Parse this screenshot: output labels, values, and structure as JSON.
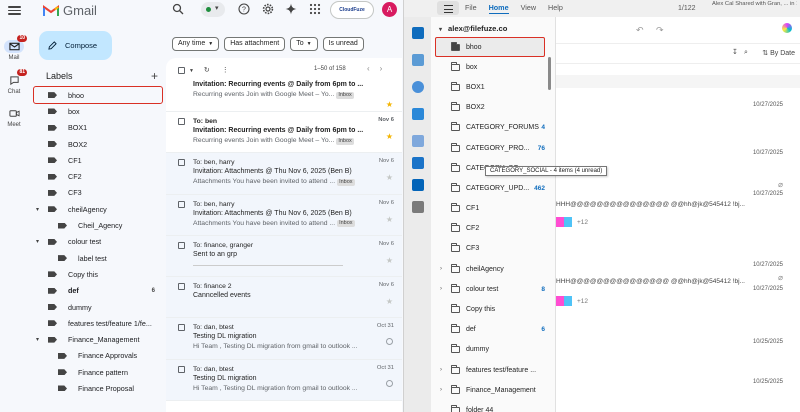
{
  "gmail": {
    "app_name": "Gmail",
    "compose_label": "Compose",
    "labels_heading": "Labels",
    "add_label": "+",
    "rail": [
      {
        "name": "Mail",
        "badge": "10"
      },
      {
        "name": "Chat",
        "badge": "81"
      },
      {
        "name": "Meet",
        "badge": ""
      }
    ],
    "cloudfuze": "CloudFuze",
    "avatar_letter": "A",
    "filters": [
      "Any time",
      "Has attachment",
      "To",
      "Is unread"
    ],
    "range": "1–50 of 158",
    "labels": [
      {
        "label": "bhoo",
        "bold": false,
        "count": "",
        "caret": ""
      },
      {
        "label": "box",
        "bold": false,
        "count": "",
        "caret": ""
      },
      {
        "label": "BOX1",
        "bold": false,
        "count": "",
        "caret": ""
      },
      {
        "label": "BOX2",
        "bold": false,
        "count": "",
        "caret": ""
      },
      {
        "label": "CF1",
        "bold": false,
        "count": "",
        "caret": ""
      },
      {
        "label": "CF2",
        "bold": false,
        "count": "",
        "caret": ""
      },
      {
        "label": "CF3",
        "bold": false,
        "count": "",
        "caret": ""
      },
      {
        "label": "cheilAgency",
        "bold": false,
        "count": "",
        "caret": "▾"
      },
      {
        "label": "Cheil_Agency",
        "bold": false,
        "count": "",
        "caret": "",
        "indent": true
      },
      {
        "label": "colour test",
        "bold": false,
        "count": "",
        "caret": "▾"
      },
      {
        "label": "label test",
        "bold": false,
        "count": "",
        "caret": "",
        "indent": true
      },
      {
        "label": "Copy this",
        "bold": false,
        "count": "",
        "caret": ""
      },
      {
        "label": "def",
        "bold": true,
        "count": "6",
        "caret": ""
      },
      {
        "label": "dummy",
        "bold": false,
        "count": "",
        "caret": ""
      },
      {
        "label": "features test/feature 1/fe...",
        "bold": false,
        "count": "",
        "caret": ""
      },
      {
        "label": "Finance_Management",
        "bold": false,
        "count": "",
        "caret": "▾"
      },
      {
        "label": "Finance Approvals",
        "bold": false,
        "count": "",
        "caret": "",
        "indent": true
      },
      {
        "label": "Finance pattern",
        "bold": false,
        "count": "",
        "caret": "",
        "indent": true
      },
      {
        "label": "Finance Proposal",
        "bold": false,
        "count": "",
        "caret": "",
        "indent": true
      }
    ],
    "mails": [
      {
        "from": "",
        "date": "",
        "subject": "Invitation: Recurring events @ Daily from 6pm to ...",
        "snippet": "Recurring events Join with Google Meet – Yo...",
        "tag": "Inbox",
        "star": true,
        "unread": true,
        "first": true
      },
      {
        "from": "To: ben",
        "date": "Nov 6",
        "subject": "Invitation: Recurring events @ Daily from 6pm to ...",
        "snippet": "Recurring events Join with Google Meet – Yo...",
        "tag": "Inbox",
        "star": true,
        "unread": true
      },
      {
        "from": "To: ben, harry",
        "date": "Nov 6",
        "subject": "Invitation: Attachments @ Thu Nov 6, 2025 (Ben B)",
        "snippet": "Attachments You have been invited to attend ...",
        "tag": "Inbox",
        "star": false,
        "unread": false
      },
      {
        "from": "To: ben, harry",
        "date": "Nov 6",
        "subject": "Invitation: Attachments @ Thu Nov 6, 2025 (Ben B)",
        "snippet": "Attachments You have been invited to attend ...",
        "tag": "Inbox",
        "star": false,
        "unread": false
      },
      {
        "from": "To: finance, granger",
        "date": "Nov 6",
        "subject": "Sent to an grp",
        "snippet": "",
        "tag": "",
        "star": false,
        "unread": false,
        "line": true
      },
      {
        "from": "To: finance 2",
        "date": "Nov 6",
        "subject": "Canncelled events",
        "snippet": "",
        "tag": "",
        "star": false,
        "unread": false
      },
      {
        "from": "To: dan, btest",
        "date": "Oct 31",
        "subject": "Testing DL migration",
        "snippet": "Hi Team , Testing DL migration from gmail to outlook ...",
        "tag": "",
        "star": false,
        "unread": false,
        "clock": true
      },
      {
        "from": "To: dan, btest",
        "date": "Oct 31",
        "subject": "Testing DL migration",
        "snippet": "Hi Team , Testing DL migration from gmail to outlook ...",
        "tag": "",
        "star": false,
        "unread": false,
        "clock": true
      }
    ]
  },
  "outlook": {
    "tabs": [
      "File",
      "Home",
      "View",
      "Help"
    ],
    "active_tab": "Home",
    "pager": "1/122",
    "notification": "Alex Cal Shared with Gran, ... in 10 min Microsoft Teams ...",
    "account": "alex@filefuze.co",
    "sort_label": "By Date",
    "tooltip": "CATEGORY_SOCIAL - 4 items (4 unread)",
    "folders": [
      {
        "label": "bhoo",
        "count": "",
        "expand": ""
      },
      {
        "label": "box",
        "count": "",
        "expand": ""
      },
      {
        "label": "BOX1",
        "count": "",
        "expand": ""
      },
      {
        "label": "BOX2",
        "count": "",
        "expand": ""
      },
      {
        "label": "CATEGORY_FORUMS",
        "count": "4",
        "expand": ""
      },
      {
        "label": "CATEGORY_PRO...",
        "count": "76",
        "expand": ""
      },
      {
        "label": "CATEGORY_SO...",
        "count": "",
        "expand": ""
      },
      {
        "label": "CATEGORY_UPD...",
        "count": "462",
        "expand": ""
      },
      {
        "label": "CF1",
        "count": "",
        "expand": ""
      },
      {
        "label": "CF2",
        "count": "",
        "expand": ""
      },
      {
        "label": "CF3",
        "count": "",
        "expand": ""
      },
      {
        "label": "cheilAgency",
        "count": "",
        "expand": "›"
      },
      {
        "label": "colour test",
        "count": "8",
        "expand": "›"
      },
      {
        "label": "Copy this",
        "count": "",
        "expand": ""
      },
      {
        "label": "def",
        "count": "6",
        "expand": ""
      },
      {
        "label": "dummy",
        "count": "",
        "expand": ""
      },
      {
        "label": "features test/feature ...",
        "count": "",
        "expand": "›"
      },
      {
        "label": "Finance_Management",
        "count": "",
        "expand": "›"
      },
      {
        "label": "folder 44",
        "count": "",
        "expand": ""
      }
    ],
    "dates": [
      "10/27/2025",
      "10/27/2025",
      "10/27/2025",
      "10/27/2025",
      "10/27/2025",
      "10/25/2025",
      "10/25/2025"
    ],
    "garble": "HHH@@@@@@@@@@@@@@@ @@hh@jk@545412 !bj...",
    "more": "+12"
  }
}
